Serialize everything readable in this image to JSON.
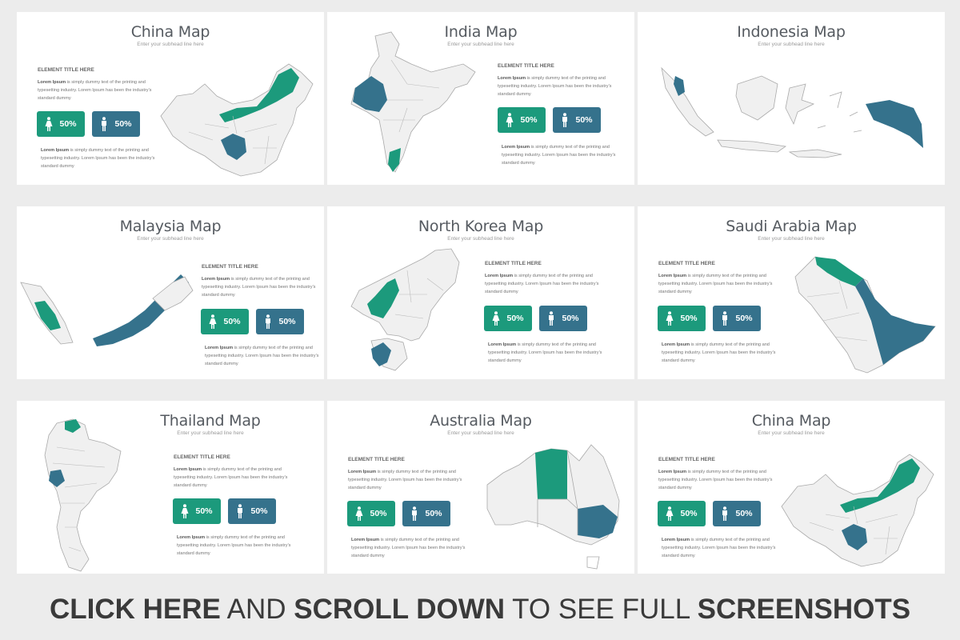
{
  "colors": {
    "accent_green": "#1c9a7c",
    "accent_blue": "#35728c",
    "map_fill": "#f0f0f0",
    "map_stroke": "#aaaaaa"
  },
  "slides": [
    {
      "title": "China Map",
      "subtitle": "Enter your subhead line here",
      "element_title": "ELEMENT TITLE HERE",
      "para1_bold": "Lorem Ipsum",
      "para1": " is simply dummy text of the printing and typesetting industry. Lorem Ipsum has been the industry's standard dummy",
      "para2_bold": "Lorem Ipsum",
      "para2": " is simply dummy text of the printing and typesetting industry. Lorem Ipsum has been the industry's standard dummy",
      "female": "50%",
      "male": "50%"
    },
    {
      "title": "India Map",
      "subtitle": "Enter your subhead line here",
      "element_title": "ELEMENT TITLE HERE",
      "para1_bold": "Lorem Ipsum",
      "para1": " is simply dummy text of the printing and typesetting industry. Lorem Ipsum has been the industry's standard dummy",
      "para2_bold": "Lorem Ipsum",
      "para2": " is simply dummy text of the printing and typesetting industry. Lorem Ipsum has been the industry's standard dummy",
      "female": "50%",
      "male": "50%"
    },
    {
      "title": "Indonesia Map",
      "subtitle": "Enter your subhead line here"
    },
    {
      "title": "Malaysia Map",
      "subtitle": "Enter your subhead line here",
      "element_title": "ELEMENT TITLE HERE",
      "para1_bold": "Lorem Ipsum",
      "para1": " is simply dummy text of the printing and typesetting industry. Lorem Ipsum has been the industry's standard dummy",
      "para2_bold": "Lorem Ipsum",
      "para2": " is simply dummy text of the printing and typesetting industry. Lorem Ipsum has been the industry's standard dummy",
      "female": "50%",
      "male": "50%"
    },
    {
      "title": "North Korea Map",
      "subtitle": "Enter your subhead line here",
      "element_title": "ELEMENT TITLE HERE",
      "para1_bold": "Lorem Ipsum",
      "para1": " is simply dummy text of the printing and typesetting industry. Lorem Ipsum has been the industry's standard dummy",
      "para2_bold": "Lorem Ipsum",
      "para2": " is simply dummy text of the printing and typesetting industry. Lorem Ipsum has been the industry's standard dummy",
      "female": "50%",
      "male": "50%"
    },
    {
      "title": "Saudi Arabia Map",
      "subtitle": "Enter your subhead line here",
      "element_title": "ELEMENT TITLE HERE",
      "para1_bold": "Lorem Ipsum",
      "para1": " is simply dummy text of the printing and typesetting industry. Lorem Ipsum has been the industry's standard dummy",
      "para2_bold": "Lorem Ipsum",
      "para2": " is simply dummy text of the printing and typesetting industry. Lorem Ipsum has been the industry's standard dummy",
      "female": "50%",
      "male": "50%"
    },
    {
      "title": "Thailand Map",
      "subtitle": "Enter your subhead line here",
      "element_title": "ELEMENT TITLE HERE",
      "para1_bold": "Lorem Ipsum",
      "para1": " is simply dummy text of the printing and typesetting industry. Lorem Ipsum has been the industry's standard dummy",
      "para2_bold": "Lorem Ipsum",
      "para2": " is simply dummy text of the printing and typesetting industry. Lorem Ipsum has been the industry's standard dummy",
      "female": "50%",
      "male": "50%"
    },
    {
      "title": "Australia Map",
      "subtitle": "Enter your subhead line here",
      "element_title": "ELEMENT TITLE HERE",
      "para1_bold": "Lorem Ipsum",
      "para1": " is simply dummy text of the printing and typesetting industry. Lorem Ipsum has been the industry's standard dummy",
      "para2_bold": "Lorem Ipsum",
      "para2": " is simply dummy text of the printing and typesetting industry. Lorem Ipsum has been the industry's standard dummy",
      "female": "50%",
      "male": "50%"
    },
    {
      "title": "China Map",
      "subtitle": "Enter your subhead line here",
      "element_title": "ELEMENT TITLE HERE",
      "para1_bold": "Lorem Ipsum",
      "para1": " is simply dummy text of the printing and typesetting industry. Lorem Ipsum has been the industry's standard dummy",
      "para2_bold": "Lorem Ipsum",
      "para2": " is simply dummy text of the printing and typesetting industry. Lorem Ipsum has been the industry's standard dummy",
      "female": "50%",
      "male": "50%"
    }
  ],
  "footer": {
    "part1": "CLICK HERE",
    "part2": " AND ",
    "part3": "SCROLL DOWN",
    "part4": " TO SEE FULL ",
    "part5": "SCREENSHOTS"
  }
}
